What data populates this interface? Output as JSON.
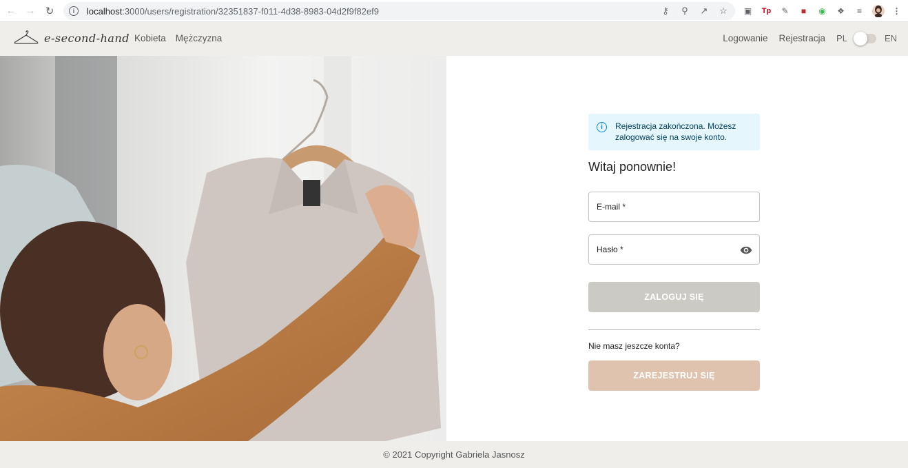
{
  "browser": {
    "url_host": "localhost",
    "url_rest": ":3000/users/registration/32351837-f011-4d38-8983-04d2f9f82ef9"
  },
  "header": {
    "logo_text": "e-second-hand",
    "nav_left": [
      "Kobieta",
      "Mężczyzna"
    ],
    "login": "Logowanie",
    "register": "Rejestracja",
    "lang_pl": "PL",
    "lang_en": "EN"
  },
  "form": {
    "alert": "Rejestracja zakończona. Możesz zalogować się na swoje konto.",
    "greeting": "Witaj ponownie!",
    "email_label": "E-mail *",
    "password_label": "Hasło *",
    "login_button": "ZALOGUJ SIĘ",
    "no_account": "Nie masz jeszcze konta?",
    "register_button": "ZAREJESTRUJ SIĘ"
  },
  "footer": {
    "copyright": "© 2021 Copyright Gabriela Jasnosz"
  },
  "colors": {
    "header_bg": "#efeeeb",
    "login_button_bg": "#cbcac5",
    "register_button_bg": "#e0c3ae",
    "alert_bg": "#e5f6fd",
    "alert_icon": "#0288d1"
  }
}
